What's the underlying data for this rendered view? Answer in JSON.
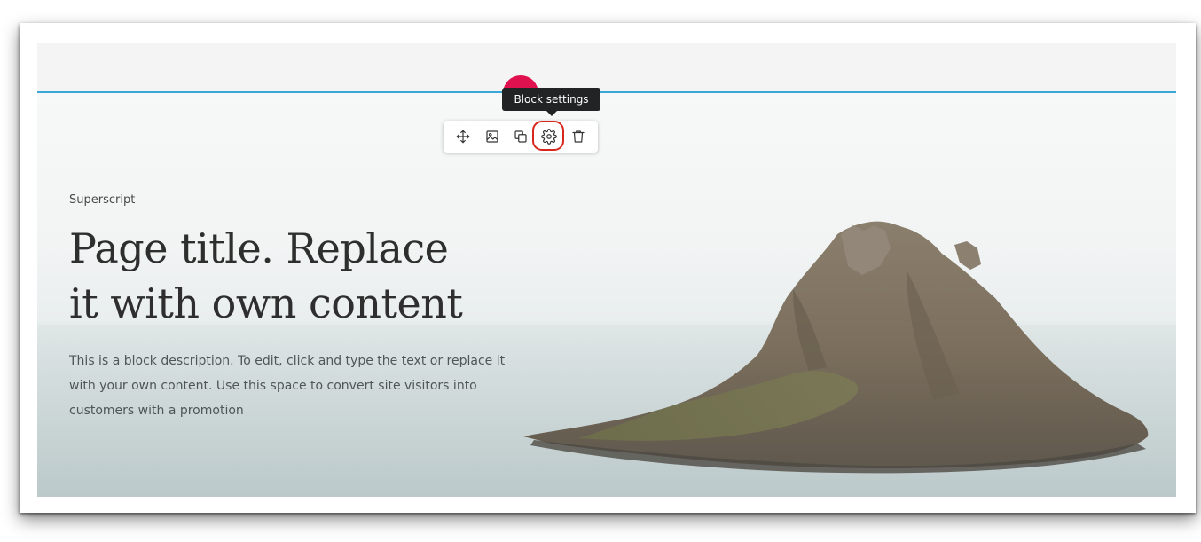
{
  "hero": {
    "superscript": "Superscript",
    "title_line1": "Page title. Replace",
    "title_line2": "it with own content",
    "description": "This is a block description. To edit, click and type the text or replace it with your own content. Use this space to convert site visitors into customers with a promotion"
  },
  "toolbar": {
    "tooltip": "Block settings",
    "items": [
      {
        "icon": "move-icon"
      },
      {
        "icon": "image-icon"
      },
      {
        "icon": "duplicate-icon"
      },
      {
        "icon": "gear-icon",
        "highlighted": true
      },
      {
        "icon": "trash-icon"
      }
    ]
  },
  "colors": {
    "selection_line": "#3aa7d9",
    "highlight_ring": "#d9261c",
    "pink_dot": "#e0114f",
    "tooltip_bg": "#222324"
  }
}
